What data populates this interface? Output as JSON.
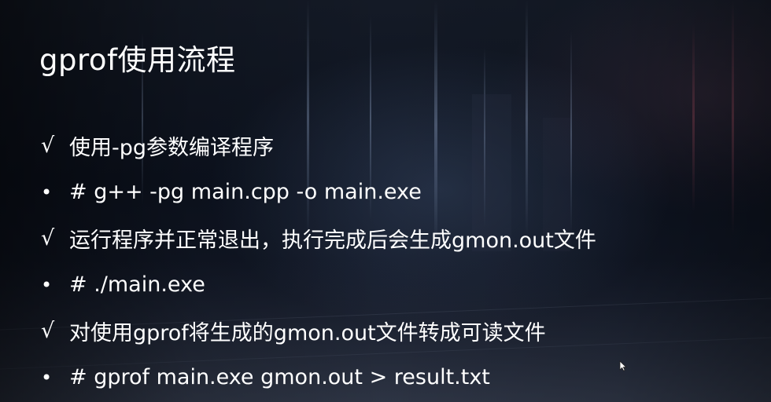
{
  "title": "gprof使用流程",
  "bullets": [
    {
      "marker": "√",
      "text": "使用-pg参数编译程序"
    },
    {
      "marker": "•",
      "text": "# g++ -pg main.cpp -o main.exe"
    },
    {
      "marker": "√",
      "text": "运行程序并正常退出，执行完成后会生成gmon.out文件"
    },
    {
      "marker": "•",
      "text": "# ./main.exe"
    },
    {
      "marker": "√",
      "text": "对使用gprof将生成的gmon.out文件转成可读文件"
    },
    {
      "marker": "•",
      "text": "# gprof main.exe gmon.out > result.txt"
    }
  ],
  "colors": {
    "text": "#ffffff",
    "background": "#0d1320"
  },
  "icons": {
    "cursor": "mouse-pointer-icon"
  }
}
